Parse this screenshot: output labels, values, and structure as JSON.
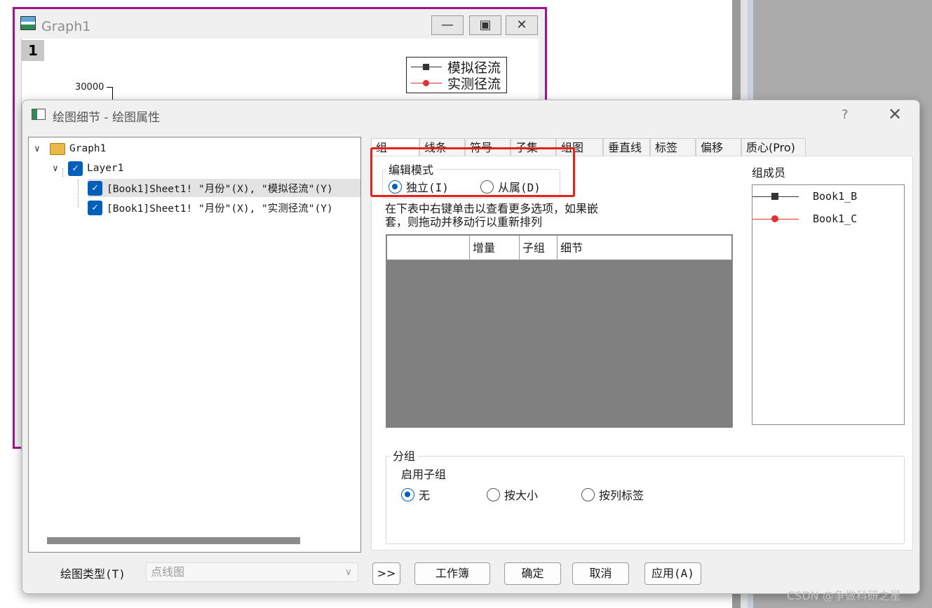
{
  "graph_window": {
    "title": "Graph1",
    "layer_badge": "1",
    "y_tick": "30000",
    "legend": [
      {
        "label": "模拟径流",
        "color": "#333333",
        "marker": "square"
      },
      {
        "label": "实测径流",
        "color": "#e03030",
        "marker": "circle"
      }
    ],
    "border_color": "#a0148e"
  },
  "dialog": {
    "title": "绘图细节 - 绘图属性",
    "help": "?",
    "close": "✕"
  },
  "tree": {
    "root": "Graph1",
    "layer": "Layer1",
    "plots": [
      "[Book1]Sheet1! \"月份\"(X), \"模拟径流\"(Y)",
      "[Book1]Sheet1! \"月份\"(X), \"实测径流\"(Y)"
    ]
  },
  "tabs": [
    "组",
    "线条",
    "符号",
    "子集",
    "组图",
    "垂直线",
    "标签",
    "偏移",
    "质心(Pro)"
  ],
  "edit_mode": {
    "title": "编辑模式",
    "options": [
      "独立(I)",
      "从属(D)"
    ],
    "selected": "独立(I)"
  },
  "instructions": "在下表中右键单击以查看更多选项，如果嵌套，则拖动并移动行以重新排列",
  "table_headers": [
    "",
    "增量",
    "子组",
    "细节"
  ],
  "members": {
    "title": "组成员",
    "items": [
      {
        "label": "Book1_B",
        "color": "#333333",
        "marker": "square"
      },
      {
        "label": "Book1_C",
        "color": "#e03030",
        "marker": "circle"
      }
    ]
  },
  "grouping": {
    "title": "分组",
    "subtitle": "启用子组",
    "options": [
      "无",
      "按大小",
      "按列标签"
    ],
    "selected": "无"
  },
  "bottom": {
    "plot_type_label": "绘图类型(T)",
    "plot_type_value": "点线图",
    "expand": ">>",
    "workbook": "工作簿",
    "ok": "确定",
    "cancel": "取消",
    "apply": "应用(A)"
  },
  "watermark": "CSDN @争做科研之星",
  "accent_color": "#005fb8",
  "highlight_color": "#e8201c"
}
